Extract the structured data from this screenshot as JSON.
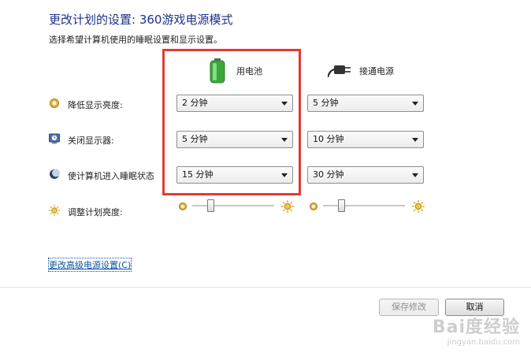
{
  "header": {
    "title": "更改计划的设置: 360游戏电源模式",
    "subtitle": "选择希望计算机使用的睡眠设置和显示设置。"
  },
  "columns": {
    "battery": {
      "label": "用电池",
      "icon": "battery-icon"
    },
    "plugged": {
      "label": "接通电源",
      "icon": "power-plug-icon"
    }
  },
  "rows": [
    {
      "label": "降低显示亮度:",
      "icon": "brightness-dim-icon",
      "battery": "2 分钟",
      "plugged": "5 分钟"
    },
    {
      "label": "关闭显示器:",
      "icon": "monitor-clock-icon",
      "battery": "5 分钟",
      "plugged": "10 分钟"
    },
    {
      "label": "使计算机进入睡眠状态",
      "icon": "moon-sleep-icon",
      "battery": "15 分钟",
      "plugged": "30 分钟"
    }
  ],
  "brightness": {
    "label": "调整计划亮度:",
    "icon": "sun-icon",
    "battery_level": 0.2,
    "plugged_level": 0.2
  },
  "advanced_link": "更改高级电源设置(C)",
  "buttons": {
    "save": "保存修改",
    "cancel": "取消"
  },
  "watermark": {
    "brand": "Bai度经验",
    "url": "jingyan.baidu.com"
  },
  "colors": {
    "title": "#1e3287",
    "highlight": "#e53935",
    "link": "#0b53a6"
  }
}
